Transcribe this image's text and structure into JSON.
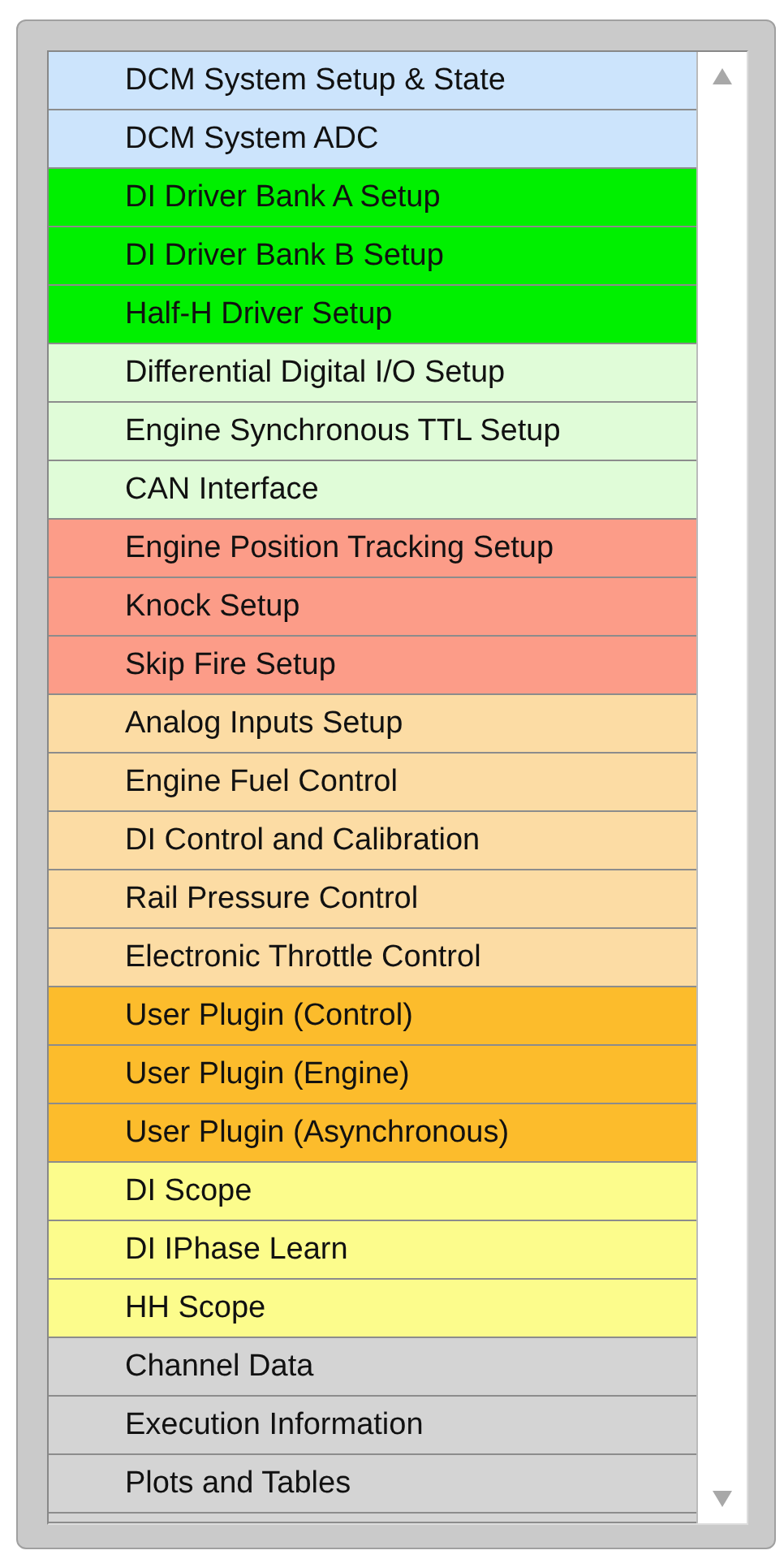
{
  "items": [
    {
      "label": "DCM System Setup & State",
      "color": "#cce4fc"
    },
    {
      "label": "DCM System ADC",
      "color": "#cce4fc"
    },
    {
      "label": "DI Driver Bank A Setup",
      "color": "#00f000"
    },
    {
      "label": "DI Driver Bank B Setup",
      "color": "#00f000"
    },
    {
      "label": "Half-H Driver Setup",
      "color": "#00f000"
    },
    {
      "label": "Differential Digital I/O Setup",
      "color": "#e0fcd8"
    },
    {
      "label": "Engine Synchronous TTL Setup",
      "color": "#e0fcd8"
    },
    {
      "label": "CAN Interface",
      "color": "#e0fcd8"
    },
    {
      "label": "Engine Position Tracking Setup",
      "color": "#fc9c88"
    },
    {
      "label": "Knock Setup",
      "color": "#fc9c88"
    },
    {
      "label": "Skip Fire Setup",
      "color": "#fc9c88"
    },
    {
      "label": "Analog Inputs Setup",
      "color": "#fcdca4"
    },
    {
      "label": "Engine Fuel Control",
      "color": "#fcdca4"
    },
    {
      "label": "DI Control and Calibration",
      "color": "#fcdca4"
    },
    {
      "label": "Rail Pressure Control",
      "color": "#fcdca4"
    },
    {
      "label": "Electronic Throttle Control",
      "color": "#fcdca4"
    },
    {
      "label": "User Plugin (Control)",
      "color": "#fcbc2c"
    },
    {
      "label": "User Plugin (Engine)",
      "color": "#fcbc2c"
    },
    {
      "label": "User Plugin (Asynchronous)",
      "color": "#fcbc2c"
    },
    {
      "label": "DI Scope",
      "color": "#fcfc8c"
    },
    {
      "label": "DI IPhase Learn",
      "color": "#fcfc8c"
    },
    {
      "label": "HH Scope",
      "color": "#fcfc8c"
    },
    {
      "label": "Channel Data",
      "color": "#d4d4d4"
    },
    {
      "label": "Execution Information",
      "color": "#d4d4d4"
    },
    {
      "label": "Plots and Tables",
      "color": "#d4d4d4"
    }
  ]
}
